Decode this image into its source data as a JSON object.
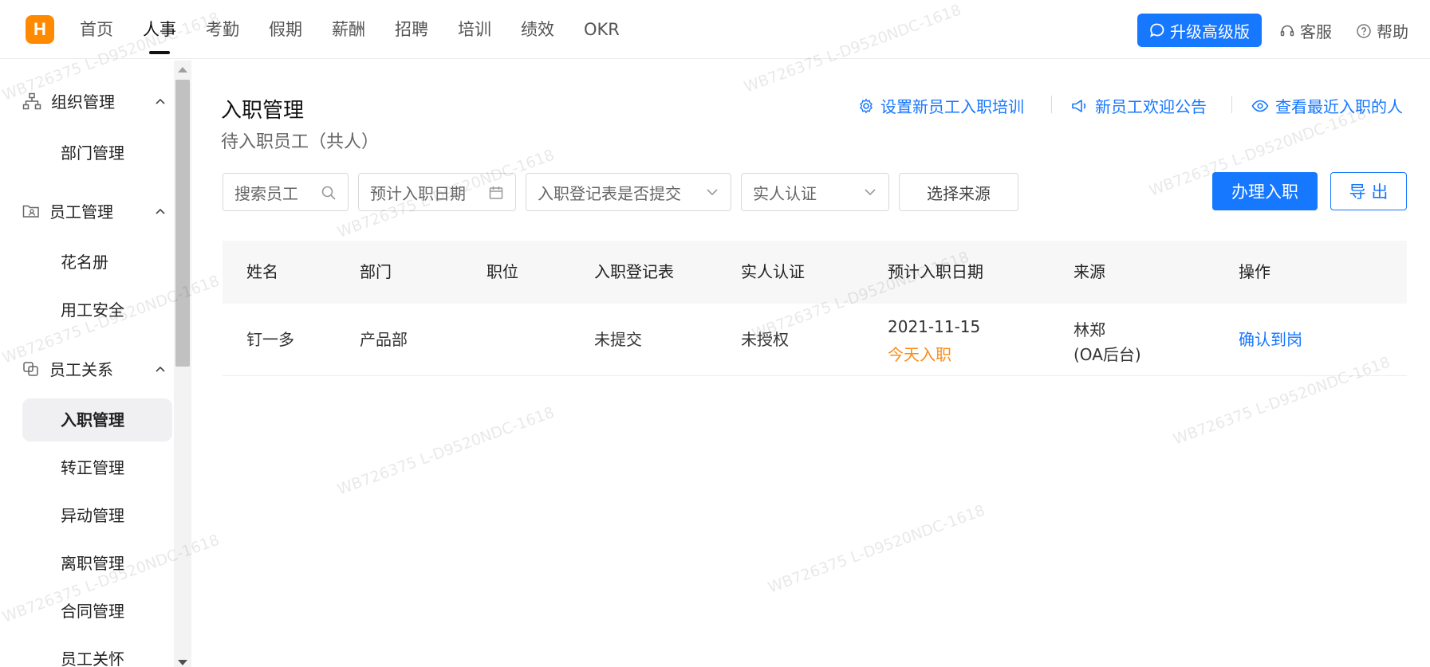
{
  "brand": {
    "logo_letter": "H",
    "color": "#ff8a00"
  },
  "nav": {
    "items": [
      {
        "label": "首页",
        "active": false
      },
      {
        "label": "人事",
        "active": true
      },
      {
        "label": "考勤",
        "active": false
      },
      {
        "label": "假期",
        "active": false
      },
      {
        "label": "薪酬",
        "active": false
      },
      {
        "label": "招聘",
        "active": false
      },
      {
        "label": "培训",
        "active": false
      },
      {
        "label": "绩效",
        "active": false
      },
      {
        "label": "OKR",
        "active": false
      }
    ],
    "upgrade_label": "升级高级版",
    "service_label": "客服",
    "help_label": "帮助"
  },
  "sidebar": {
    "groups": [
      {
        "label": "组织管理",
        "icon": "org-tree-icon",
        "items": [
          {
            "label": "部门管理"
          }
        ]
      },
      {
        "label": "员工管理",
        "icon": "folder-user-icon",
        "items": [
          {
            "label": "花名册"
          },
          {
            "label": "用工安全"
          }
        ]
      },
      {
        "label": "员工关系",
        "icon": "relation-icon",
        "items": [
          {
            "label": "入职管理",
            "active": true
          },
          {
            "label": "转正管理"
          },
          {
            "label": "异动管理"
          },
          {
            "label": "离职管理"
          },
          {
            "label": "合同管理"
          },
          {
            "label": "员工关怀"
          }
        ]
      }
    ]
  },
  "page": {
    "title": "入职管理",
    "subtitle": "待入职员工（共人）",
    "links": {
      "training": "设置新员工入职培训",
      "announcement": "新员工欢迎公告",
      "recent": "查看最近入职的人"
    }
  },
  "filters": {
    "search_placeholder": "搜索员工",
    "date_placeholder": "预计入职日期",
    "form_submitted": "入职登记表是否提交",
    "verification": "实人认证",
    "source": "选择来源"
  },
  "actions": {
    "onboard": "办理入职",
    "export": "导 出"
  },
  "table": {
    "columns": [
      "姓名",
      "部门",
      "职位",
      "入职登记表",
      "实人认证",
      "预计入职日期",
      "来源",
      "操作"
    ],
    "rows": [
      {
        "name": "钉一多",
        "department": "产品部",
        "position": "",
        "form": "未提交",
        "verification": "未授权",
        "date": "2021-11-15",
        "date_note": "今天入职",
        "source_line1": "林郑",
        "source_line2": "(OA后台)",
        "action": "确认到岗"
      }
    ]
  },
  "watermark": "WB726375 L-D9520NDC-1618",
  "colors": {
    "primary": "#1677ff",
    "warning": "#fa8c16"
  }
}
